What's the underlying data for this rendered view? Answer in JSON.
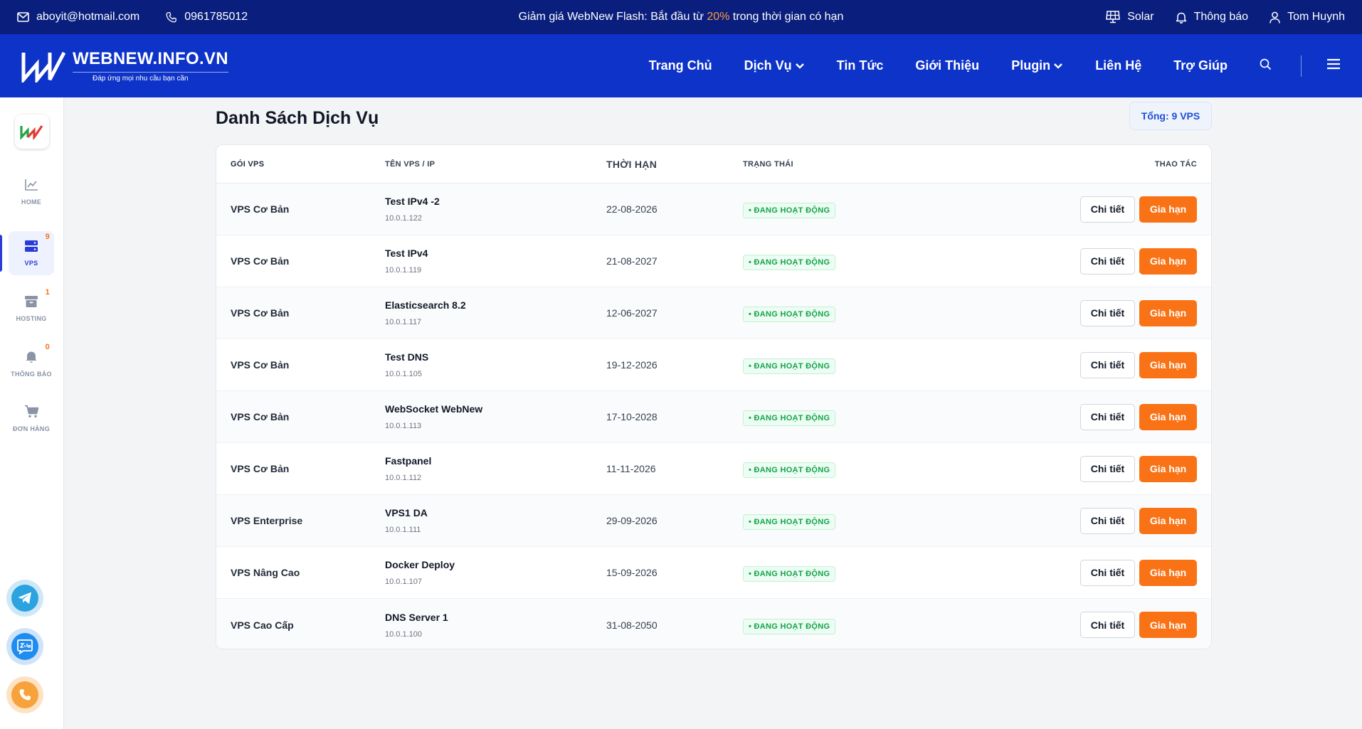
{
  "topbar": {
    "email": "aboyit@hotmail.com",
    "phone": "0961785012",
    "promo_before": "Giảm giá WebNew Flash: Bắt đầu từ ",
    "promo_percent": "20%",
    "promo_after": " trong thời gian có hạn",
    "theme_label": "Solar",
    "notifications_label": "Thông báo",
    "user_name": "Tom Huynh"
  },
  "header": {
    "logo_name": "WEBNEW.INFO.VN",
    "logo_tagline": "Đáp ứng mọi nhu cầu bạn cần",
    "nav": {
      "home": "Trang Chủ",
      "services": "Dịch Vụ",
      "news": "Tin Tức",
      "about": "Giới Thiệu",
      "plugin": "Plugin",
      "contact": "Liên Hệ",
      "help": "Trợ Giúp"
    }
  },
  "sidebar": {
    "home": {
      "label": "HOME"
    },
    "vps": {
      "label": "VPS",
      "count": "9"
    },
    "hosting": {
      "label": "HOSTING",
      "count": "1"
    },
    "notifications": {
      "label": "THÔNG BÁO",
      "count": "0"
    },
    "orders": {
      "label": "ĐƠN HÀNG"
    }
  },
  "main": {
    "title": "Danh Sách Dịch Vụ",
    "total": "Tổng: 9 VPS",
    "columns": {
      "package": "GÓI VPS",
      "name": "TÊN VPS / IP",
      "expiry": "THỜI HẠN",
      "status": "TRẠNG THÁI",
      "actions": "THAO TÁC"
    },
    "detail_label": "Chi tiết",
    "renew_label": "Gia hạn",
    "rows": [
      {
        "package": "VPS Cơ Bản",
        "name": "Test IPv4 -2",
        "ip": "10.0.1.122",
        "expiry": "22-08-2026",
        "status": "• ĐANG HOẠT ĐỘNG"
      },
      {
        "package": "VPS Cơ Bản",
        "name": "Test IPv4",
        "ip": "10.0.1.119",
        "expiry": "21-08-2027",
        "status": "• ĐANG HOẠT ĐỘNG"
      },
      {
        "package": "VPS Cơ Bản",
        "name": "Elasticsearch 8.2",
        "ip": "10.0.1.117",
        "expiry": "12-06-2027",
        "status": "• ĐANG HOẠT ĐỘNG"
      },
      {
        "package": "VPS Cơ Bản",
        "name": "Test DNS",
        "ip": "10.0.1.105",
        "expiry": "19-12-2026",
        "status": "• ĐANG HOẠT ĐỘNG"
      },
      {
        "package": "VPS Cơ Bản",
        "name": "WebSocket WebNew",
        "ip": "10.0.1.113",
        "expiry": "17-10-2028",
        "status": "• ĐANG HOẠT ĐỘNG"
      },
      {
        "package": "VPS Cơ Bản",
        "name": "Fastpanel",
        "ip": "10.0.1.112",
        "expiry": "11-11-2026",
        "status": "• ĐANG HOẠT ĐỘNG"
      },
      {
        "package": "VPS Enterprise",
        "name": "VPS1 DA",
        "ip": "10.0.1.111",
        "expiry": "29-09-2026",
        "status": "• ĐANG HOẠT ĐỘNG"
      },
      {
        "package": "VPS Nâng Cao",
        "name": "Docker Deploy",
        "ip": "10.0.1.107",
        "expiry": "15-09-2026",
        "status": "• ĐANG HOẠT ĐỘNG"
      },
      {
        "package": "VPS Cao Cấp",
        "name": "DNS Server 1",
        "ip": "10.0.1.100",
        "expiry": "31-08-2050",
        "status": "• ĐANG HOẠT ĐỘNG"
      }
    ]
  },
  "icons": {
    "email": "mail-icon",
    "phone": "phone-icon",
    "theme": "solar-panel-icon",
    "bell": "bell-icon",
    "user": "user-icon",
    "search": "search-icon",
    "menu": "hamburger-menu-icon",
    "chart": "chart-line-icon",
    "server": "server-icon",
    "archive": "archive-icon",
    "cart": "cart-icon",
    "telegram": "telegram-icon",
    "zalo": "zalo-icon",
    "call": "call-icon"
  },
  "colors": {
    "topbar": "#0a1f7d",
    "header": "#0d33c9",
    "accent": "#f97316",
    "status_green": "#16a34a",
    "active_blue": "#2b3bd6"
  }
}
